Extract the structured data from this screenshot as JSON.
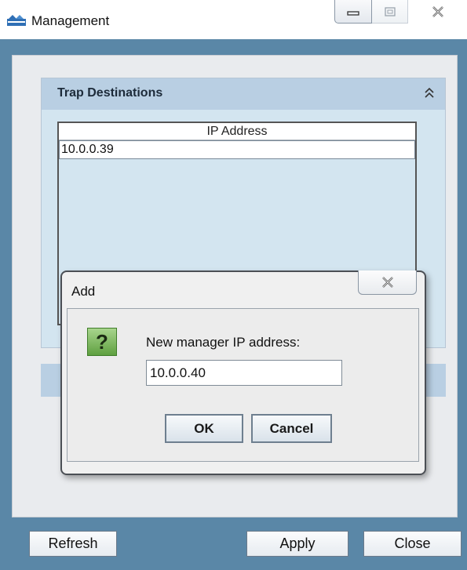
{
  "window": {
    "title": "Management"
  },
  "panel": {
    "title": "Trap Destinations",
    "table": {
      "column_header": "IP Address",
      "rows": [
        "10.0.0.39"
      ]
    }
  },
  "buttons": {
    "refresh": "Refresh",
    "apply": "Apply",
    "close": "Close"
  },
  "dialog": {
    "title": "Add",
    "question_glyph": "?",
    "prompt": "New manager IP address:",
    "input_value": "10.0.0.40",
    "ok": "OK",
    "cancel": "Cancel"
  },
  "colors": {
    "window_frame": "#5a87a7",
    "panel_header": "#b9cfe3",
    "panel_body": "#d3e5f0",
    "question_icon": "#6fae50"
  },
  "icons": [
    "app-icon",
    "minimize-icon",
    "maximize-icon",
    "close-icon",
    "collapse-up-icon",
    "dialog-close-icon",
    "question-icon"
  ]
}
